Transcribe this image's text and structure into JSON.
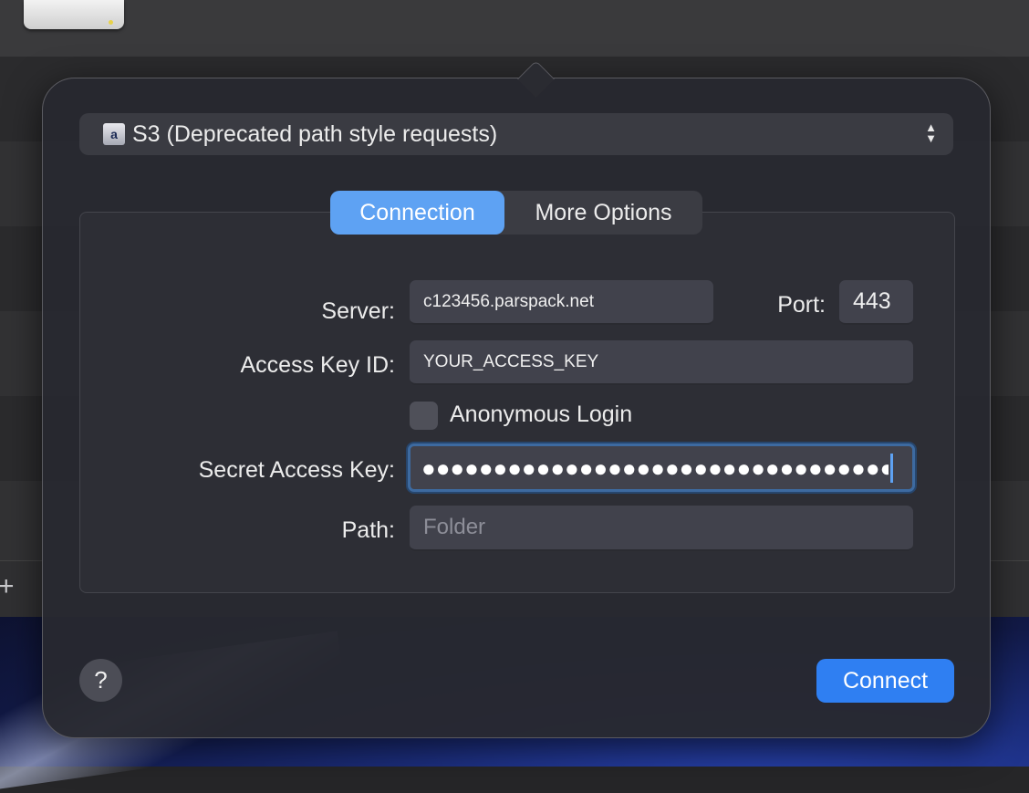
{
  "protocol": {
    "icon": "amazon-s3-icon",
    "label": "S3 (Deprecated path style requests)"
  },
  "tabs": [
    {
      "label": "Connection",
      "active": true
    },
    {
      "label": "More Options",
      "active": false
    }
  ],
  "form": {
    "server_label": "Server:",
    "server_value": "c123456.parspack.net",
    "port_label": "Port:",
    "port_value": "443",
    "access_key_label": "Access Key ID:",
    "access_key_value": "YOUR_ACCESS_KEY",
    "anonymous_label": "Anonymous Login",
    "anonymous_checked": false,
    "secret_label": "Secret Access Key:",
    "secret_value": "●●●●●●●●●●●●●●●●●●●●●●●●●●●●●●●●●●●●●●●●",
    "path_label": "Path:",
    "path_placeholder": "Folder"
  },
  "footer": {
    "help_label": "?",
    "connect_label": "Connect"
  },
  "background": {
    "add_label": "+"
  },
  "colors": {
    "accent": "#5ea2f3",
    "connect_button": "#2f7ff2"
  }
}
